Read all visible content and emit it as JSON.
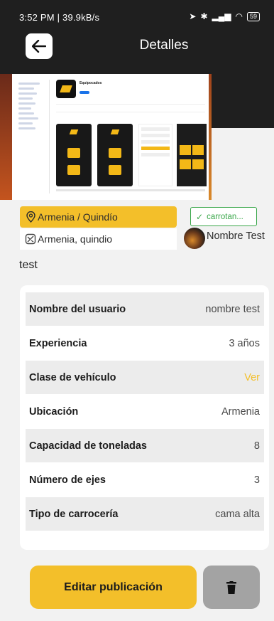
{
  "status_bar": {
    "left": "3:52 PM | 39.9kB/s",
    "battery": "59"
  },
  "header": {
    "title": "Detalles"
  },
  "publication": {
    "location": "Armenia / Quindío",
    "city": "Armenia, quindio",
    "user_chip": "carrotan...",
    "owner_name": "Nombre Test",
    "description": "test"
  },
  "details": [
    {
      "label": "Nombre del usuario",
      "value": "nombre test"
    },
    {
      "label": "Experiencia",
      "value": "3 años"
    },
    {
      "label": "Clase de vehículo",
      "value": "Ver"
    },
    {
      "label": "Ubicación",
      "value": "Armenia"
    },
    {
      "label": "Capacidad de toneladas",
      "value": "8"
    },
    {
      "label": "Número de ejes",
      "value": "3"
    },
    {
      "label": "Tipo de carrocería",
      "value": "cama alta"
    }
  ],
  "actions": {
    "edit_label": "Editar publicación"
  },
  "image_preview": {
    "app_name": "Equipocados"
  },
  "colors": {
    "accent": "#f3bf2a",
    "dark_bar": "#1f1f1f",
    "verified": "#3aa74a",
    "delete_bg": "#a3a3a3"
  }
}
